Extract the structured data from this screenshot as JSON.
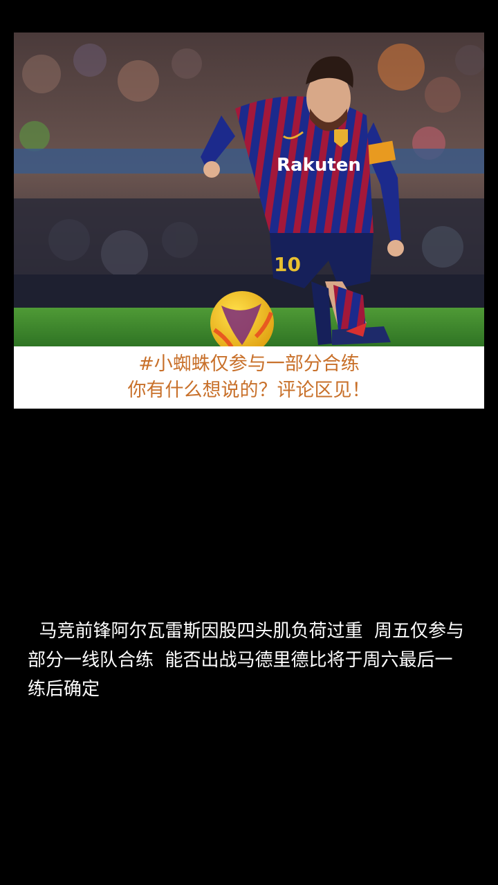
{
  "photo": {
    "jersey_sponsor": "Rakuten",
    "jersey_number": "10",
    "icons": [
      "football-player-photo",
      "soccer-ball"
    ]
  },
  "caption": {
    "line1": "#小蜘蛛仅参与一部分合练",
    "line2": "你有什么想说的？评论区见！"
  },
  "article": {
    "text": "  马竞前锋阿尔瓦雷斯因股四头肌负荷过重  周五仅参与部分一线队合练  能否出战马德里德比将于周六最后一练后确定"
  },
  "colors": {
    "background": "#000000",
    "caption_text": "#c8702a",
    "caption_bg": "#ffffff",
    "article_text": "#ffffff",
    "jersey_blue": "#1c2a8c",
    "jersey_red": "#a3183a",
    "pitch_green": "#3d8a2e"
  }
}
